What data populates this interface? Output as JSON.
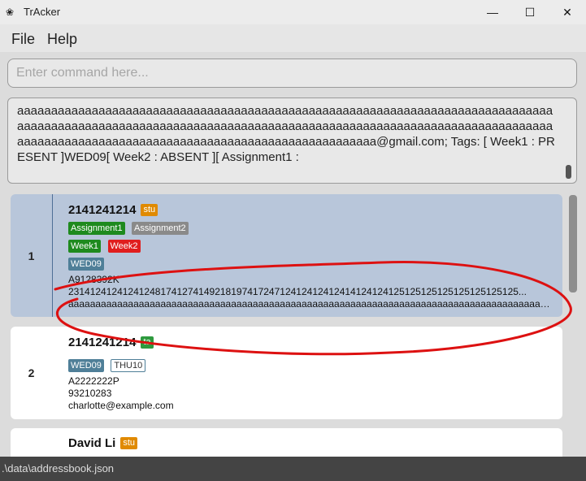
{
  "window": {
    "title": "TrAcker",
    "minimize": "—",
    "maximize": "☐",
    "close": "✕"
  },
  "menu": {
    "file": "File",
    "help": "Help"
  },
  "command": {
    "placeholder": "Enter command here..."
  },
  "result": {
    "text": "aaaaaaaaaaaaaaaaaaaaaaaaaaaaaaaaaaaaaaaaaaaaaaaaaaaaaaaaaaaaaaaaaaaaaaaaaaaaaaaaaaaaaaaaaaaaaaaaaaaaaaaaaaaaaaaaaaaaaaaaaaaaaaaaaaaaaaaaaaaaaaaaaaaaaaaaaaaaaaaaaaaaaaaaaaaaaaaaaaaaaaaaaaaaaaaaaaaaaaaaaaaaaaaaaaa@gmail.com; Tags: [ Week1 : PRESENT ]WED09[ Week2 : ABSENT ][ Assignment1 :"
  },
  "persons": [
    {
      "index": "1",
      "name": "2141241214",
      "role": "stu",
      "assignments": [
        "Assignment1",
        "Assignment2"
      ],
      "weeks": [
        "Week1",
        "Week2"
      ],
      "classes": [
        "WED09"
      ],
      "id": "A9128392K",
      "phone": "23141241241241248174127414921819741724712412412412414124124125125125125125125125125...",
      "email": "aaaaaaaaaaaaaaaaaaaaaaaaaaaaaaaaaaaaaaaaaaaaaaaaaaaaaaaaaaaaaaaaaaaaaaaaaaaaaaaaaaaaaaaaaaaaaaaaaa..."
    },
    {
      "index": "2",
      "name": "2141241214",
      "role": "ta",
      "classes": [
        "WED09",
        "THU10"
      ],
      "id": "A2222222P",
      "phone": "93210283",
      "email": "charlotte@example.com"
    },
    {
      "name": "David Li",
      "role": "stu"
    }
  ],
  "status": {
    "path": ".\\data\\addressbook.json"
  },
  "colors": {
    "selected_card": "#b8c6da",
    "tag_green": "#1e8a1e",
    "tag_gray": "#8a8a8a",
    "tag_red": "#e01e1e",
    "tag_class": "#4f7f98",
    "role_stu": "#e08a00",
    "role_ta": "#2e9a3e",
    "annotation": "#dd1111"
  },
  "icons": {
    "app": "app-logo-icon"
  }
}
